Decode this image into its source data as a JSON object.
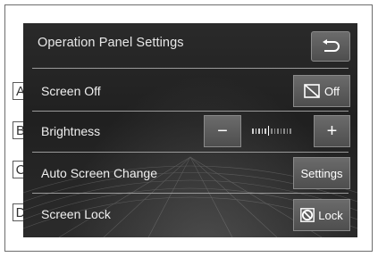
{
  "header": {
    "title": "Operation Panel Settings",
    "back_icon": "return-arrow-icon"
  },
  "markers": [
    "A",
    "B",
    "C",
    "D"
  ],
  "rows": {
    "screen_off": {
      "label": "Screen Off",
      "button_label": "Off",
      "icon": "screen-off-icon"
    },
    "brightness": {
      "label": "Brightness",
      "minus": "−",
      "plus": "+",
      "level": 0.45
    },
    "auto_screen_change": {
      "label": "Auto Screen Change",
      "button_label": "Settings"
    },
    "screen_lock": {
      "label": "Screen Lock",
      "button_label": "Lock",
      "icon": "prohibited-icon"
    }
  },
  "colors": {
    "screen_bg": "#222222",
    "button_bg": "#5a5a5a",
    "separator": "#9a9a9a",
    "text": "#f0f0f0"
  }
}
